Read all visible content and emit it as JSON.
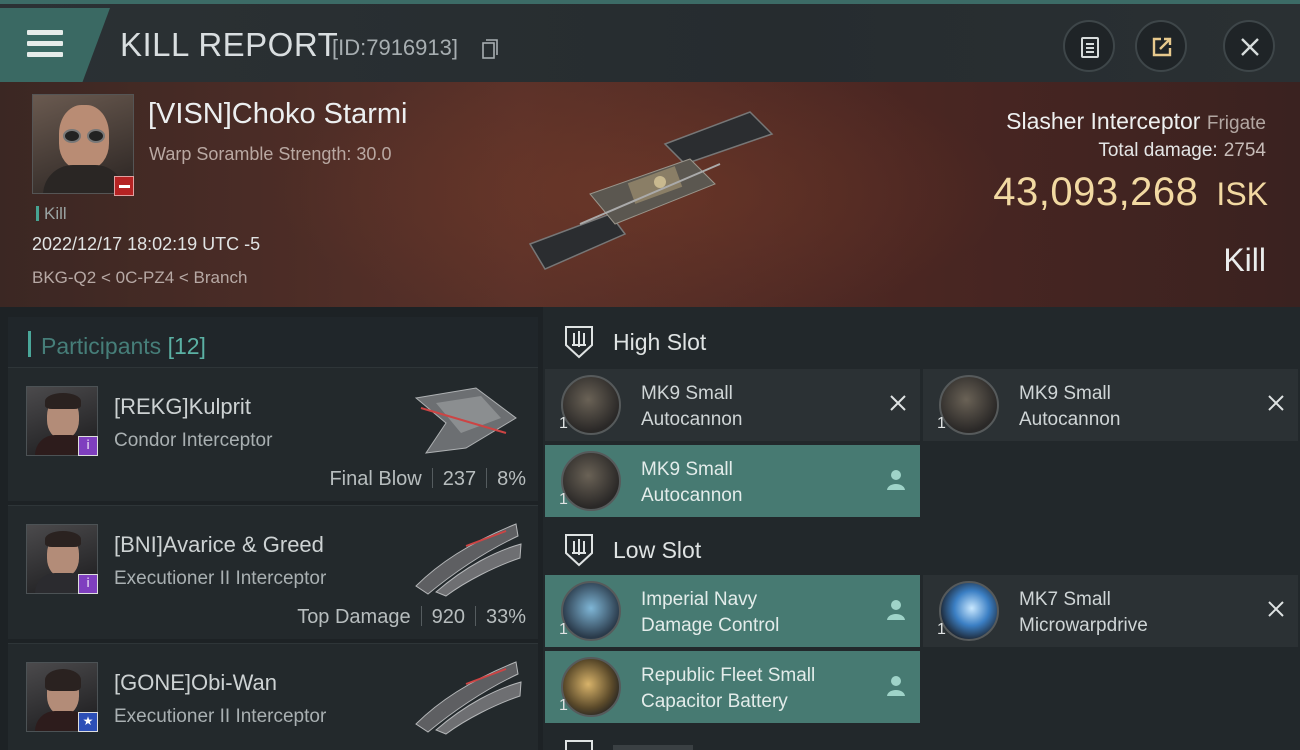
{
  "header": {
    "title": "KILL REPORT",
    "report_id": "[ID:7916913]"
  },
  "victim": {
    "name": "[VISN]Choko Starmi",
    "warp_scramble": "Warp Soramble Strength: 30.0",
    "kill_tag": "Kill",
    "time": "2022/12/17 18:02:19 UTC -5",
    "location": "BKG-Q2 < 0C-PZ4 < Branch",
    "ship": "Slasher Interceptor",
    "ship_class": "Frigate",
    "total_damage_label": "Total damage:",
    "total_damage": "2754",
    "isk_value": "43,093,268",
    "isk_unit": "ISK",
    "result": "Kill"
  },
  "participants": {
    "title": "Participants",
    "count": "[12]",
    "items": [
      {
        "name": "[REKG]Kulprit",
        "ship": "Condor Interceptor",
        "role": "Final Blow",
        "damage": "237",
        "percent": "8%",
        "badge": "i"
      },
      {
        "name": "[BNI]Avarice & Greed",
        "ship": "Executioner II Interceptor",
        "role": "Top Damage",
        "damage": "920",
        "percent": "33%",
        "badge": "i"
      },
      {
        "name": "[GONE]Obi-Wan",
        "ship": "Executioner II Interceptor",
        "badge": "★"
      }
    ]
  },
  "fitting": {
    "high_slot": {
      "title": "High Slot",
      "modules": [
        {
          "qty": "1",
          "line1": "MK9 Small",
          "line2": "Autocannon"
        },
        {
          "qty": "1",
          "line1": "MK9 Small",
          "line2": "Autocannon"
        },
        {
          "qty": "1",
          "line1": "MK9 Small",
          "line2": "Autocannon"
        }
      ]
    },
    "low_slot": {
      "title": "Low Slot",
      "modules": [
        {
          "qty": "1",
          "line1": "Imperial Navy",
          "line2": "Damage Control"
        },
        {
          "qty": "1",
          "line1": "MK7 Small",
          "line2": "Microwarpdrive"
        },
        {
          "qty": "1",
          "line1": "Republic Fleet Small",
          "line2": "Capacitor Battery"
        }
      ]
    }
  },
  "colors": {
    "accent": "#477a72",
    "isk": "#f2d9a2",
    "badge_red": "#b52323",
    "badge_purple": "#7f3fbf",
    "badge_blue": "#2c4fb7"
  },
  "icons": [
    "menu-icon",
    "copy-icon",
    "clipboard-icon",
    "share-icon",
    "close-icon",
    "high-slot-icon",
    "low-slot-icon",
    "remove-icon",
    "person-icon"
  ]
}
